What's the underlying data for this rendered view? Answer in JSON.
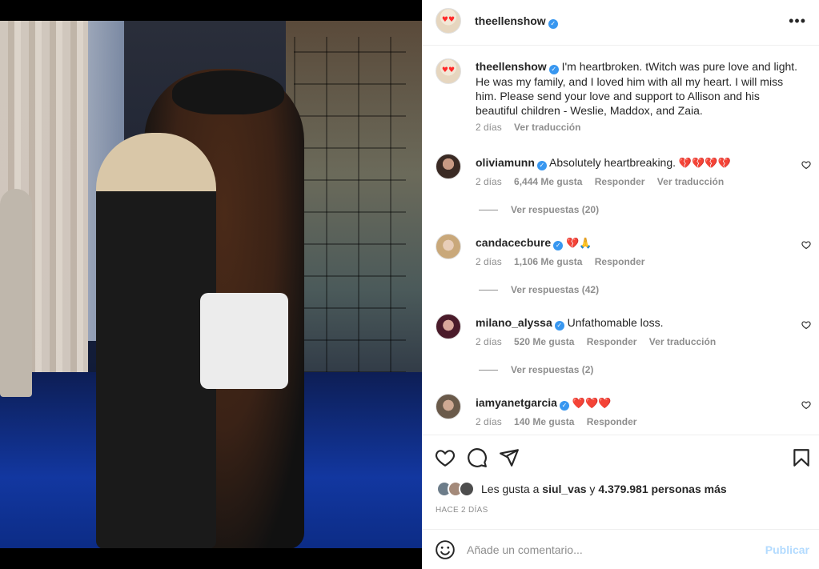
{
  "post": {
    "username": "theellenshow",
    "verified_mark": "✓",
    "more_icon": "•••",
    "caption_text": "I'm heartbroken. tWitch was pure love and light. He was my family, and I loved him with all my heart. I will miss him. Please send your love and support to Allison and his beautiful children - Weslie, Maddox, and Zaia.",
    "caption_time": "2 días",
    "caption_translate": "Ver traducción"
  },
  "comments": [
    {
      "username": "oliviamunn",
      "text": "Absolutely heartbreaking. ",
      "emoji": "💔💔💔💔",
      "time": "2 días",
      "likes": "6,444 Me gusta",
      "reply": "Responder",
      "translate": "Ver traducción",
      "replies": "Ver respuestas (20)"
    },
    {
      "username": "candacecbure",
      "text": "",
      "emoji": "💔🙏",
      "time": "2 días",
      "likes": "1,106 Me gusta",
      "reply": "Responder",
      "translate": "",
      "replies": "Ver respuestas (42)"
    },
    {
      "username": "milano_alyssa",
      "text": "Unfathomable loss.",
      "emoji": "",
      "time": "2 días",
      "likes": "520 Me gusta",
      "reply": "Responder",
      "translate": "Ver traducción",
      "replies": "Ver respuestas (2)"
    },
    {
      "username": "iamyanetgarcia",
      "text": "",
      "emoji": "❤️❤️❤️",
      "time": "2 días",
      "likes": "140 Me gusta",
      "reply": "Responder",
      "translate": "",
      "replies": ""
    }
  ],
  "actions": {
    "icons": [
      "heart-icon",
      "comment-icon",
      "share-icon",
      "bookmark-icon"
    ],
    "likes_prefix": "Les gusta a ",
    "likes_user": "siul_vas",
    "likes_mid": " y ",
    "likes_count": "4.379.981 personas más",
    "posted": "Hace 2 días"
  },
  "comment_box": {
    "placeholder": "Añade un comentario...",
    "publish": "Publicar"
  },
  "colors": {
    "link_blue": "#3897f0",
    "publish_disabled": "#b3dbff",
    "muted": "#8e8e8e"
  }
}
